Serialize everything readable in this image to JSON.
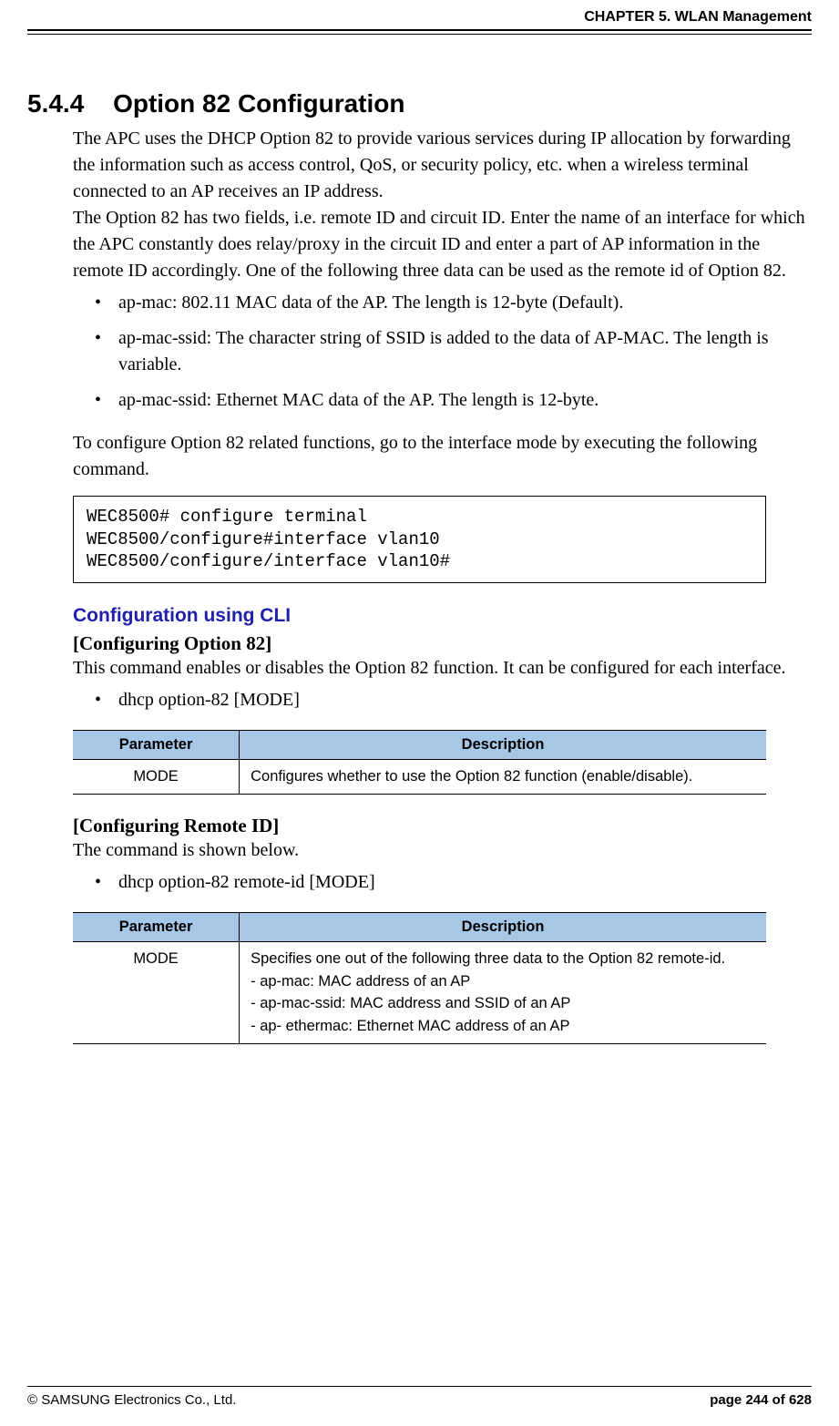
{
  "header": {
    "chapter": "CHAPTER 5. WLAN Management"
  },
  "section": {
    "number": "5.4.4",
    "title": "Option 82 Configuration",
    "intro_p1": "The APC uses the DHCP Option 82 to provide various services during IP allocation by forwarding the information such as access control, QoS, or security policy, etc. when a wireless terminal connected to an AP receives an IP address.",
    "intro_p2": "The Option 82 has two fields, i.e. remote ID and circuit ID. Enter the name of an interface for which the APC constantly does relay/proxy in the circuit ID and enter a part of AP information in the remote ID accordingly. One of the following three data can be used as the remote id of Option 82.",
    "bullets_intro": [
      "ap-mac: 802.11 MAC data of the AP. The length is 12-byte (Default).",
      "ap-mac-ssid: The character string of SSID is added to the data of AP-MAC. The length is variable.",
      "ap-mac-ssid: Ethernet MAC data of the AP. The length is 12-byte."
    ],
    "config_instruction": "To configure Option 82 related functions, go to the interface mode by executing the following command.",
    "code": "WEC8500# configure terminal\nWEC8500/configure#interface vlan10\nWEC8500/configure/interface vlan10#"
  },
  "cli": {
    "heading": "Configuration using CLI",
    "sub1": {
      "title": "[Configuring Option 82]",
      "desc": "This command enables or disables the Option 82 function. It can be configured for each interface.",
      "cmd": "dhcp option-82 [MODE]",
      "table": {
        "headers": [
          "Parameter",
          "Description"
        ],
        "rows": [
          [
            "MODE",
            "Configures whether to use the Option 82 function (enable/disable)."
          ]
        ]
      }
    },
    "sub2": {
      "title": "[Configuring Remote ID]",
      "desc": "The command is shown below.",
      "cmd": "dhcp option-82 remote-id [MODE]",
      "table": {
        "headers": [
          "Parameter",
          "Description"
        ],
        "rows": [
          [
            "MODE",
            "Specifies one out of the following three data to the Option 82 remote-id.\n- ap-mac: MAC address of an AP\n- ap-mac-ssid: MAC address and SSID of an AP\n- ap- ethermac: Ethernet MAC address of an AP"
          ]
        ]
      }
    }
  },
  "footer": {
    "left": "© SAMSUNG Electronics Co., Ltd.",
    "right": "page 244 of 628"
  }
}
